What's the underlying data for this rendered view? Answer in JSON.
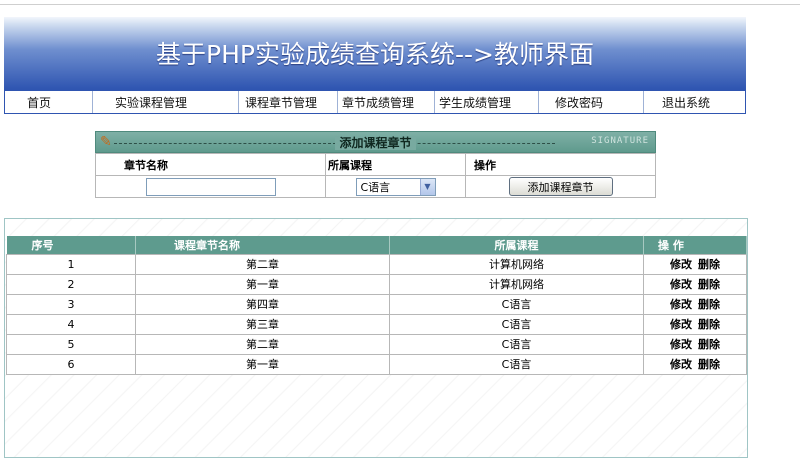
{
  "banner": {
    "title": "基于PHP实验成绩查询系统-->教师界面"
  },
  "nav": [
    {
      "label": "首页"
    },
    {
      "label": "实验课程管理"
    },
    {
      "label": "课程章节管理"
    },
    {
      "label": "章节成绩管理"
    },
    {
      "label": "学生成绩管理"
    },
    {
      "label": "修改密码"
    },
    {
      "label": "退出系统"
    }
  ],
  "add_form": {
    "title": "添加课程章节",
    "stamp": "SIGNATURE",
    "col_name": "章节名称",
    "col_course": "所属课程",
    "col_action": "操作",
    "name_value": "",
    "course_selected": "C语言",
    "submit_label": "添加课程章节"
  },
  "list": {
    "headers": [
      "序号",
      "课程章节名称",
      "所属课程",
      "操 作"
    ],
    "rows": [
      {
        "no": "1",
        "chapter": "第二章",
        "course": "计算机网络"
      },
      {
        "no": "2",
        "chapter": "第一章",
        "course": "计算机网络"
      },
      {
        "no": "3",
        "chapter": "第四章",
        "course": "C语言"
      },
      {
        "no": "4",
        "chapter": "第三章",
        "course": "C语言"
      },
      {
        "no": "5",
        "chapter": "第二章",
        "course": "C语言"
      },
      {
        "no": "6",
        "chapter": "第一章",
        "course": "C语言"
      }
    ],
    "edit_label": "修改",
    "delete_label": "删除"
  }
}
